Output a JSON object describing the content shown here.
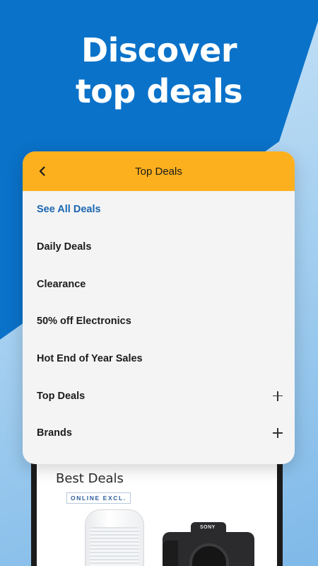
{
  "hero": {
    "line1": "Discover",
    "line2": "top deals"
  },
  "card": {
    "title": "Top Deals",
    "back_icon": "chevron-left-icon",
    "items": [
      {
        "label": "See All Deals",
        "link": true,
        "expandable": false
      },
      {
        "label": "Daily Deals",
        "link": false,
        "expandable": false
      },
      {
        "label": "Clearance",
        "link": false,
        "expandable": false
      },
      {
        "label": "50% off Electronics",
        "link": false,
        "expandable": false
      },
      {
        "label": "Hot End of Year Sales",
        "link": false,
        "expandable": false
      },
      {
        "label": "Top Deals",
        "link": false,
        "expandable": true,
        "icon": "plus-icon"
      },
      {
        "label": "Brands",
        "link": false,
        "expandable": true,
        "icon": "plus-icon"
      }
    ]
  },
  "phone": {
    "section_title": "Best Deals",
    "badge": "ONLINE EXCL.",
    "camera_brand": "SONY"
  },
  "colors": {
    "header": "#fdb01e",
    "link": "#1b66b0",
    "background_blue": "#0a72c9"
  }
}
